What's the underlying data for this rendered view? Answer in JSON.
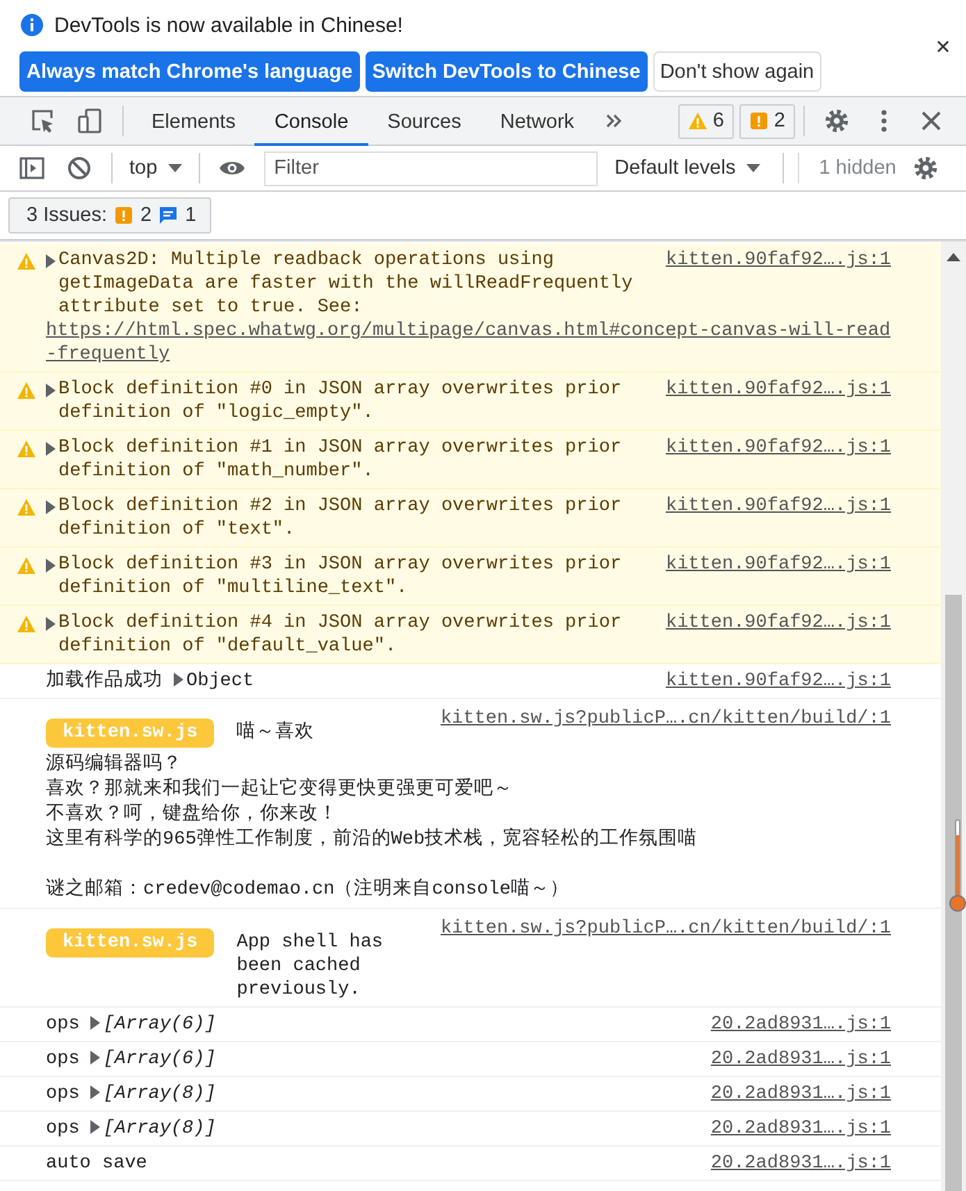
{
  "infobar": {
    "message": "DevTools is now available in Chinese!",
    "buttons": [
      {
        "label": "Always match Chrome's language",
        "kind": "primary"
      },
      {
        "label": "Switch DevTools to Chinese",
        "kind": "primary"
      },
      {
        "label": "Don't show again",
        "kind": "secondary"
      }
    ]
  },
  "tabs": [
    {
      "label": "Elements",
      "selected": false
    },
    {
      "label": "Console",
      "selected": true
    },
    {
      "label": "Sources",
      "selected": false
    },
    {
      "label": "Network",
      "selected": false
    }
  ],
  "counters": {
    "warnings": "6",
    "errors": "2"
  },
  "toolbar": {
    "context": "top",
    "filter_placeholder": "Filter",
    "levels": "Default levels",
    "hidden": "1 hidden"
  },
  "issues": {
    "label": "3 Issues:",
    "errors": "2",
    "info": "1"
  },
  "messages": [
    {
      "kind": "warning",
      "text": "Canvas2D: Multiple readback operations using getImageData are faster with the willReadFrequently attribute set to true. See: ",
      "url": "https://html.spec.whatwg.org/multipage/canvas.html#concept-canvas-will-read-frequently",
      "source": "kitten.90faf92….js:1"
    },
    {
      "kind": "warning",
      "text": "Block definition #0 in JSON array overwrites prior definition of \"logic_empty\".",
      "source": "kitten.90faf92….js:1"
    },
    {
      "kind": "warning",
      "text": "Block definition #1 in JSON array overwrites prior definition of \"math_number\".",
      "source": "kitten.90faf92….js:1"
    },
    {
      "kind": "warning",
      "text": "Block definition #2 in JSON array overwrites prior definition of \"text\".",
      "source": "kitten.90faf92….js:1"
    },
    {
      "kind": "warning",
      "text": "Block definition #3 in JSON array overwrites prior definition of \"multiline_text\".",
      "source": "kitten.90faf92….js:1"
    },
    {
      "kind": "warning",
      "text": "Block definition #4 in JSON array overwrites prior definition of \"default_value\".",
      "source": "kitten.90faf92….js:1"
    },
    {
      "kind": "log",
      "text": "加载作品成功",
      "preview": "Object",
      "italic": false,
      "source": "kitten.90faf92….js:1"
    },
    {
      "kind": "badge",
      "badge": "kitten.sw.js",
      "text": "喵～喜欢",
      "lines": [
        "源码编辑器吗？",
        "喜欢？那就来和我们一起让它变得更快更强更可爱吧～",
        "不喜欢？呵，键盘给你，你来改！",
        "这里有科学的965弹性工作制度，前沿的Web技术栈，宽容轻松的工作氛围喵"
      ],
      "footer": "谜之邮箱：credev@codemao.cn（注明来自console喵～）",
      "source": "kitten.sw.js?publicP….cn/kitten/build/:1"
    },
    {
      "kind": "badge",
      "badge": "kitten.sw.js",
      "text": "App shell has been cached previously.",
      "source": "kitten.sw.js?publicP….cn/kitten/build/:1"
    },
    {
      "kind": "log",
      "text": "ops",
      "preview": "[Array(6)]",
      "italic": true,
      "source": "20.2ad8931….js:1"
    },
    {
      "kind": "log",
      "text": "ops",
      "preview": "[Array(6)]",
      "italic": true,
      "source": "20.2ad8931….js:1"
    },
    {
      "kind": "log",
      "text": "ops",
      "preview": "[Array(8)]",
      "italic": true,
      "source": "20.2ad8931….js:1"
    },
    {
      "kind": "log",
      "text": "ops",
      "preview": "[Array(8)]",
      "italic": true,
      "source": "20.2ad8931….js:1"
    },
    {
      "kind": "log",
      "text": "auto save",
      "source": "20.2ad8931….js:1"
    }
  ]
}
